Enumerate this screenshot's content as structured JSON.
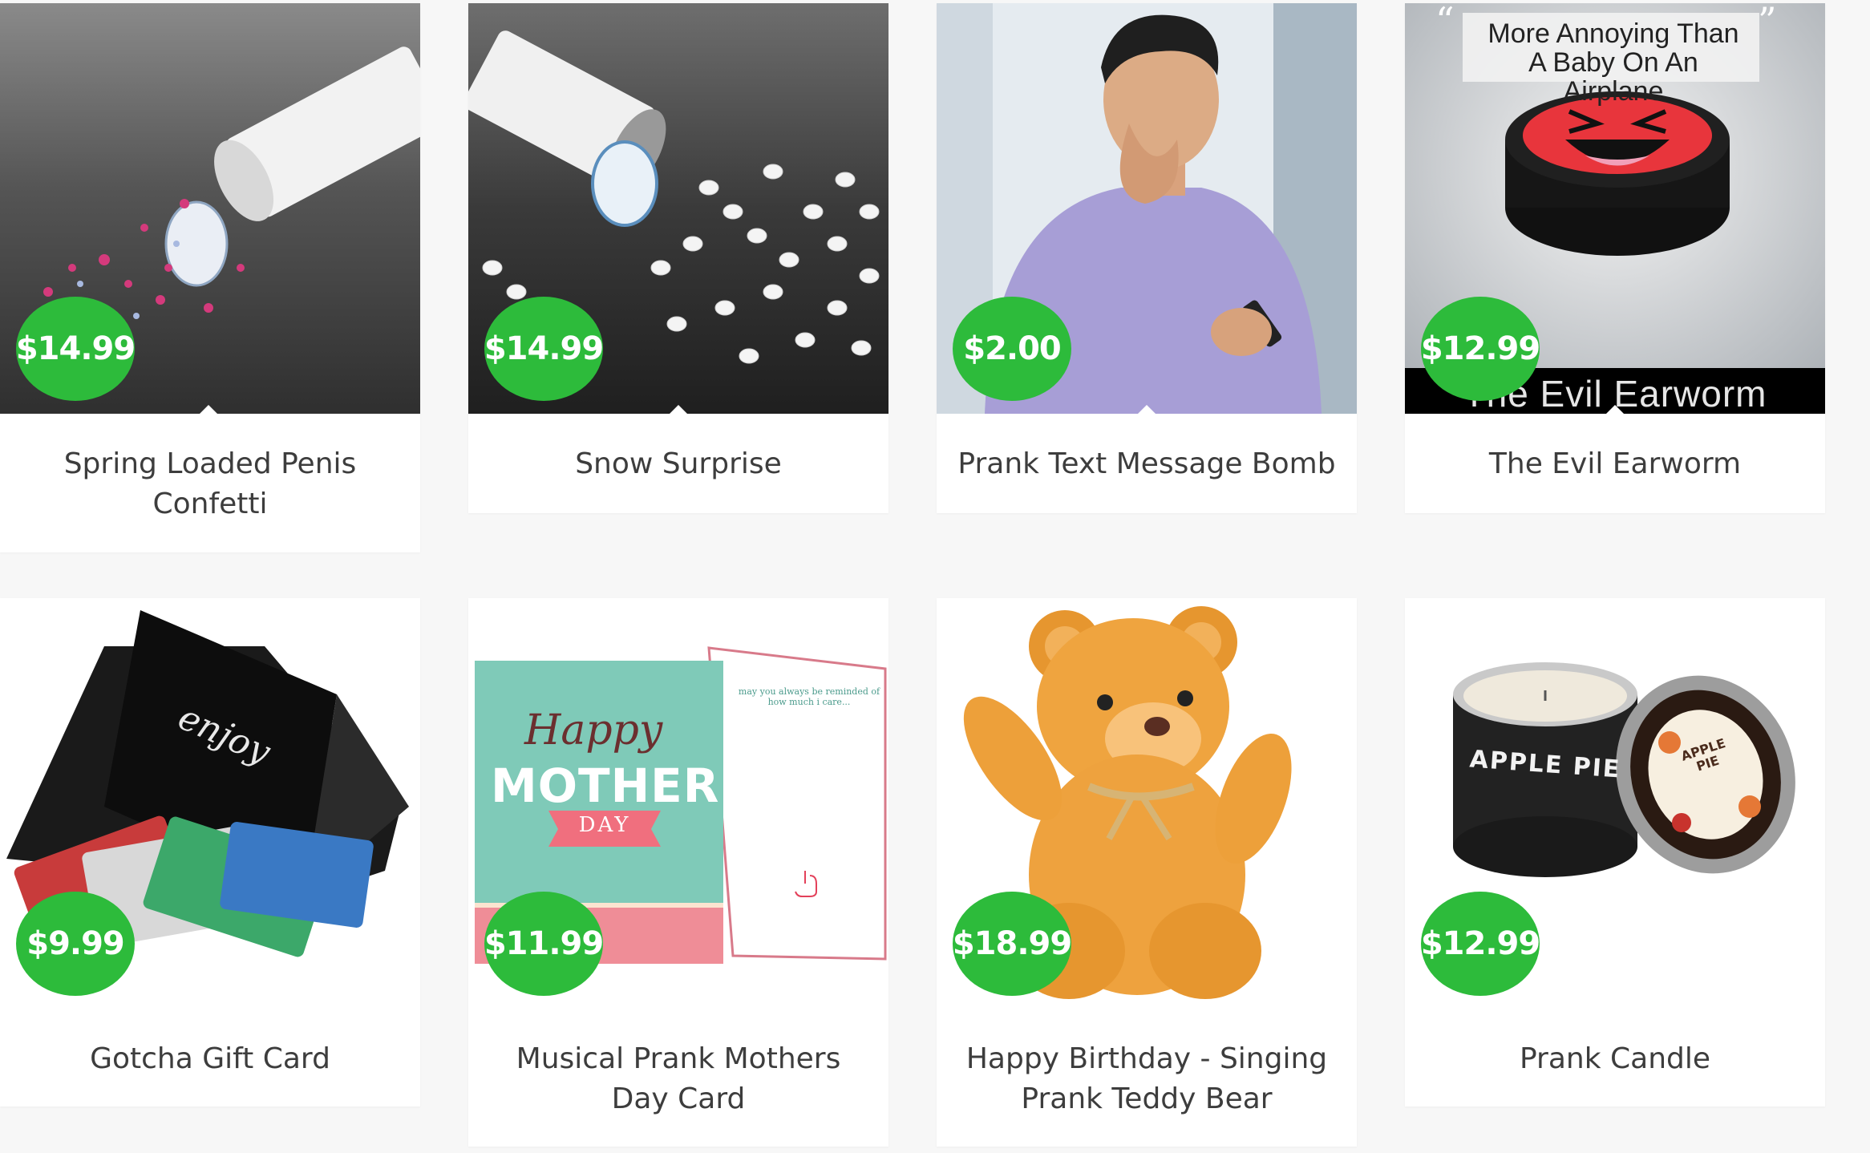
{
  "products": [
    {
      "price": "$14.99",
      "title": "Spring Loaded Penis Confetti"
    },
    {
      "price": "$14.99",
      "title": "Snow Surprise"
    },
    {
      "price": "$2.00",
      "title": "Prank Text Message Bomb"
    },
    {
      "price": "$12.99",
      "title": "The Evil Earworm",
      "overlay_top": "More Annoying Than A Baby On An Airplane",
      "overlay_bottom": "The Evil Earworm"
    },
    {
      "price": "$9.99",
      "title": "Gotcha Gift Card",
      "card_text": "enjoy"
    },
    {
      "price": "$11.99",
      "title": "Musical Prank Mothers Day Card",
      "card_script": "Happy",
      "card_big": "MOTHER'S",
      "card_ribbon": "DAY",
      "card_inner": "may you always be reminded of how much i care..."
    },
    {
      "price": "$18.99",
      "title": "Happy Birthday - Singing Prank Teddy Bear"
    },
    {
      "price": "$12.99",
      "title": "Prank Candle",
      "tin_label": "APPLE PIE",
      "lid_label": "APPLE PIE"
    }
  ],
  "colors": {
    "price_badge": "#2dbb3b",
    "title_text": "#3d3d3d",
    "background": "#f7f7f7"
  }
}
